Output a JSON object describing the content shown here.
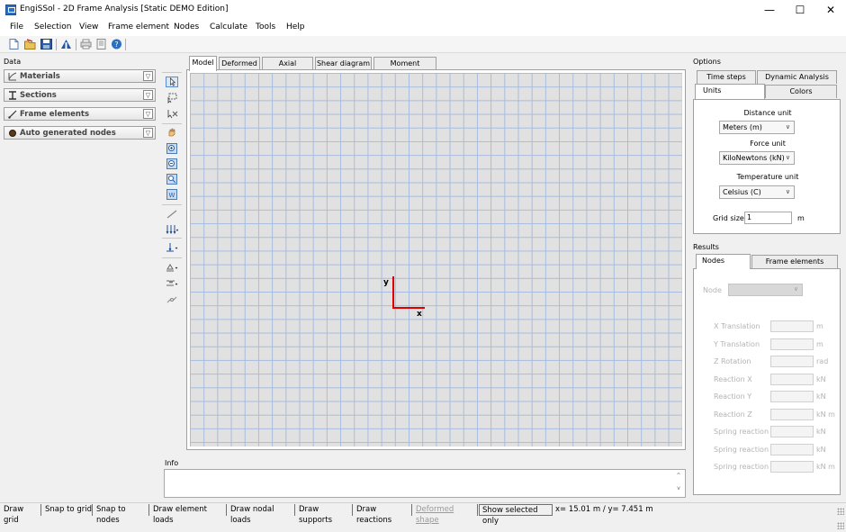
{
  "window": {
    "title": "EngiSSol - 2D Frame Analysis [Static DEMO Edition]",
    "minimize": "—",
    "maximize": "☐",
    "close": "✕"
  },
  "menu": [
    "File",
    "Selection",
    "View",
    "Frame element",
    "Nodes",
    "Calculate",
    "Tools",
    "Help"
  ],
  "data_panel": {
    "label": "Data",
    "sections": [
      "Materials",
      "Sections",
      "Frame elements",
      "Auto generated nodes"
    ],
    "chevron": "▽"
  },
  "model_tabs": [
    "Model",
    "Deformed",
    "Axial diagram",
    "Shear diagram",
    "Moment diagram"
  ],
  "canvas": {
    "y_axis_label": "y",
    "x_axis_label": "x"
  },
  "info": {
    "label": "Info",
    "scroll_up": "^",
    "scroll_down": "v"
  },
  "options": {
    "title": "Options",
    "tabs_row1": [
      "Time steps",
      "Dynamic Analysis"
    ],
    "tabs_row2": [
      "Units",
      "Colors"
    ],
    "distance_unit_label": "Distance unit",
    "distance_unit_value": "Meters (m)",
    "force_unit_label": "Force unit",
    "force_unit_value": "KiloNewtons (kN)",
    "temperature_unit_label": "Temperature unit",
    "temperature_unit_value": "Celsius (C)",
    "grid_size_label": "Grid size",
    "grid_size_value": "1",
    "grid_size_unit": "m",
    "select_arrow": "∨"
  },
  "results": {
    "title": "Results",
    "tabs": [
      "Nodes",
      "Frame elements"
    ],
    "node_label": "Node",
    "rows": [
      {
        "label": "X Translation",
        "unit": "m"
      },
      {
        "label": "Y Translation",
        "unit": "m"
      },
      {
        "label": "Z Rotation",
        "unit": "rad"
      },
      {
        "label": "Reaction X",
        "unit": "kN"
      },
      {
        "label": "Reaction Y",
        "unit": "kN"
      },
      {
        "label": "Reaction Z",
        "unit": "kN m"
      },
      {
        "label": "Spring reaction X",
        "unit": "kN"
      },
      {
        "label": "Spring reaction Y",
        "unit": "kN"
      },
      {
        "label": "Spring reaction Z",
        "unit": "kN m"
      }
    ]
  },
  "statusbar": {
    "buttons": [
      "Draw grid",
      "Snap to grid",
      "Snap to nodes",
      "Draw element loads",
      "Draw nodal loads",
      "Draw supports",
      "Draw reactions",
      "Deformed shape",
      "Show selected only"
    ],
    "coordinates": "x= 15.01 m / y= 7.451 m"
  },
  "colors": {
    "accent": "#2a6fc1",
    "axis": "#e00000",
    "grid_line": "#a7bcdd",
    "grid_bg": "#e1e1e1"
  }
}
